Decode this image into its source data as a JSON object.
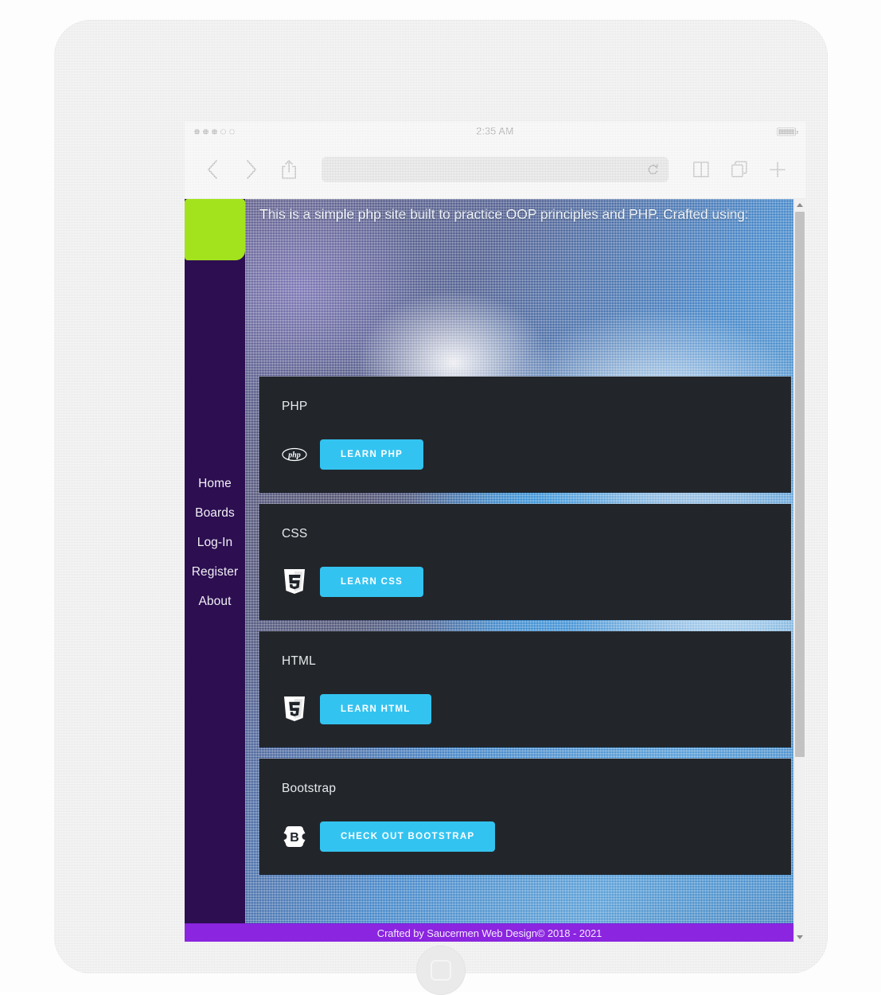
{
  "device": {
    "status_bar": {
      "signal_filled": 3,
      "signal_total": 5,
      "time": "2:35 AM",
      "battery_icon": "battery-full-icon"
    },
    "toolbar": {
      "back_icon": "chevron-left-icon",
      "forward_icon": "chevron-right-icon",
      "share_icon": "share-up-arrow-icon",
      "url_value": "",
      "url_placeholder": "",
      "reload_icon": "reload-icon",
      "bookmarks_icon": "book-icon",
      "tabs_icon": "tabs-icon",
      "newtab_icon": "plus-icon"
    },
    "home_button": "home-button"
  },
  "page": {
    "logo_block_color": "#a3e31d",
    "sidebar": {
      "background_color": "#2c0e51",
      "items": [
        {
          "label": "Home"
        },
        {
          "label": "Boards"
        },
        {
          "label": "Log-In"
        },
        {
          "label": "Register"
        },
        {
          "label": "About"
        }
      ]
    },
    "hero": {
      "tagline": "This is a simple php site built to practice OOP principles and PHP. Crafted using:"
    },
    "cards": [
      {
        "title": "PHP",
        "logo": "php-logo-icon",
        "button_label": "LEARN PHP"
      },
      {
        "title": "CSS",
        "logo": "css3-shield-icon",
        "button_label": "LEARN CSS"
      },
      {
        "title": "HTML",
        "logo": "html5-shield-icon",
        "button_label": "LEARN HTML"
      },
      {
        "title": "Bootstrap",
        "logo": "bootstrap-b-icon",
        "button_label": "CHECK OUT BOOTSTRAP"
      }
    ],
    "footer": {
      "text": "Crafted by Saucermen Web Design© 2018 - 2021",
      "background_color": "#8b25e0"
    },
    "accent_color": "#33c3f0",
    "card_background_color": "#22262b"
  },
  "scrollbar": {
    "up_icon": "scroll-up-arrow-icon",
    "down_icon": "scroll-down-arrow-icon"
  }
}
